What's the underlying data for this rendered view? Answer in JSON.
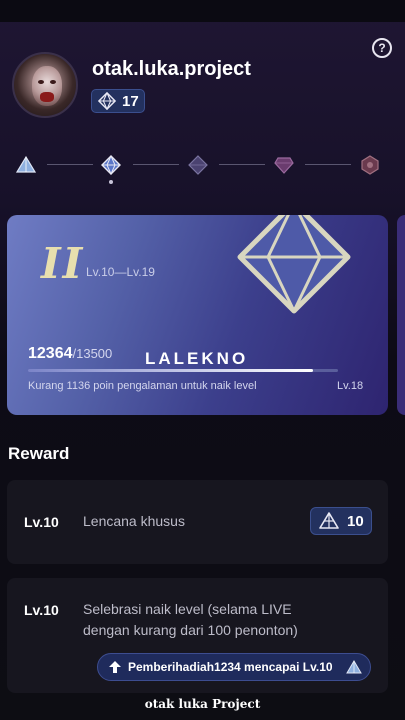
{
  "profile": {
    "username": "otak.luka.project",
    "level": "17"
  },
  "card": {
    "roman": "II",
    "range": "Lv.10—Lv.19",
    "points_current": "12364",
    "points_total": "/13500",
    "progress_fraction": 0.92,
    "tier_name": "LALEKNO",
    "need_text": "Kurang 1136 poin pengalaman untuk naik level",
    "next_level": "Lv.18"
  },
  "section_title": "Reward",
  "rewards": [
    {
      "level": "Lv.10",
      "desc": "Lencana khusus",
      "badge_value": "10"
    },
    {
      "level": "Lv.10",
      "desc_line1": "Selebrasi naik level (selama LIVE",
      "desc_line2": "dengan kurang dari 100 penonton)",
      "pill_text": "Pemberihadiah1234 mencapai Lv.10"
    }
  ],
  "watermark": "otak luka Project",
  "icons": {
    "help": "question-icon",
    "tiers": [
      "tier-1-icon",
      "tier-2-icon",
      "tier-3-icon",
      "tier-4-icon",
      "tier-5-icon"
    ]
  },
  "colors": {
    "card_gradient_start": "#6f7cc4",
    "card_gradient_end": "#2e2470",
    "badge_bg": "#23315f",
    "gold": "#e8dfae"
  }
}
